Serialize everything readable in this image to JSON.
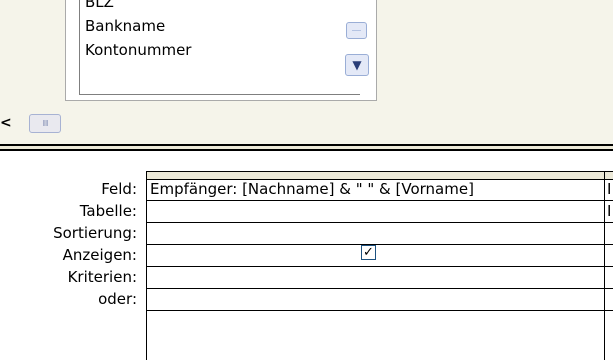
{
  "field_list": {
    "items": [
      "BLZ",
      "Bankname",
      "Kontonummer"
    ],
    "scroll_down_icon": "chevron-down-icon"
  },
  "hscroll": {
    "left_arrow_icon": "chevron-left-icon",
    "thumb_grip": "IIII"
  },
  "grid": {
    "row_labels": {
      "feld": "Feld:",
      "tabelle": "Tabelle:",
      "sortierung": "Sortierung:",
      "anzeigen": "Anzeigen:",
      "kriterien": "Kriterien:",
      "oder": "oder:"
    },
    "column1": {
      "feld": "Empfänger: [Nachname] & \" \" & [Vorname]",
      "tabelle": "",
      "sortierung": "",
      "anzeigen_checked": true,
      "kriterien": "",
      "oder": ""
    },
    "column2": {
      "feld": "I",
      "tabelle": "I"
    }
  }
}
